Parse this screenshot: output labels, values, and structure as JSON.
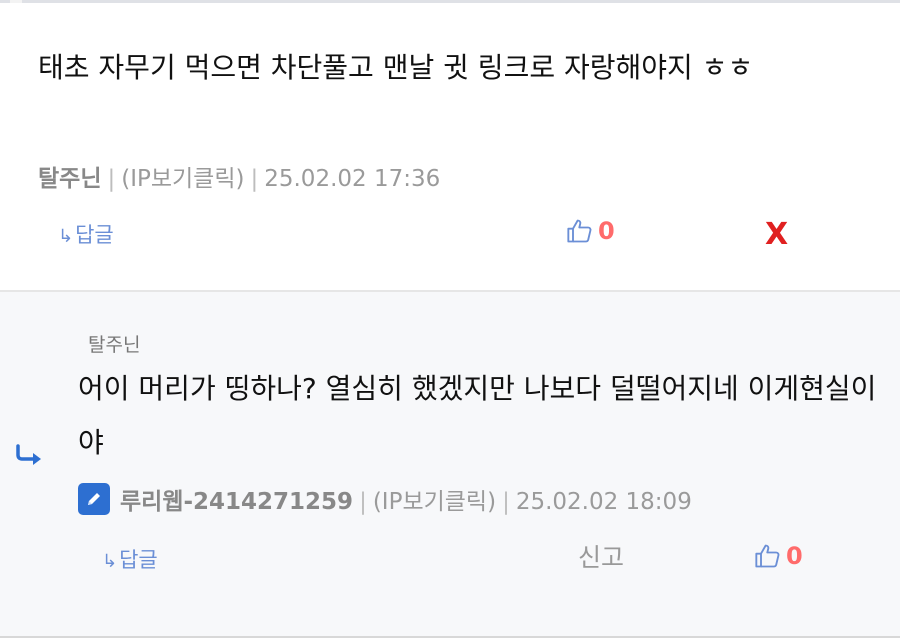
{
  "comment": {
    "text": "태초 자무기 먹으면 차단풀고 맨날 귓 링크로 자랑해야지 ㅎㅎ",
    "author": "탈주닌",
    "ip_label": "(IP보기클릭)",
    "datetime": "25.02.02 17:36",
    "reply_label": "답글",
    "likes": "0",
    "delete_label": "X"
  },
  "reply": {
    "parent_author": "탈주닌",
    "text": "어이 머리가 띵하나? 열심히 했겠지만 나보다 덜떨어지네 이게현실이야",
    "author": "루리웹-2414271259",
    "ip_label": "(IP보기클릭)",
    "datetime": "25.02.02 18:09",
    "reply_label": "답글",
    "report_label": "신고",
    "likes": "0"
  },
  "colors": {
    "accent_blue": "#6b8fd6",
    "like_red": "#ff6b6b",
    "delete_red": "#e02020",
    "reply_bg": "#f7f8fa",
    "pencil_blue": "#2d6fd1"
  }
}
